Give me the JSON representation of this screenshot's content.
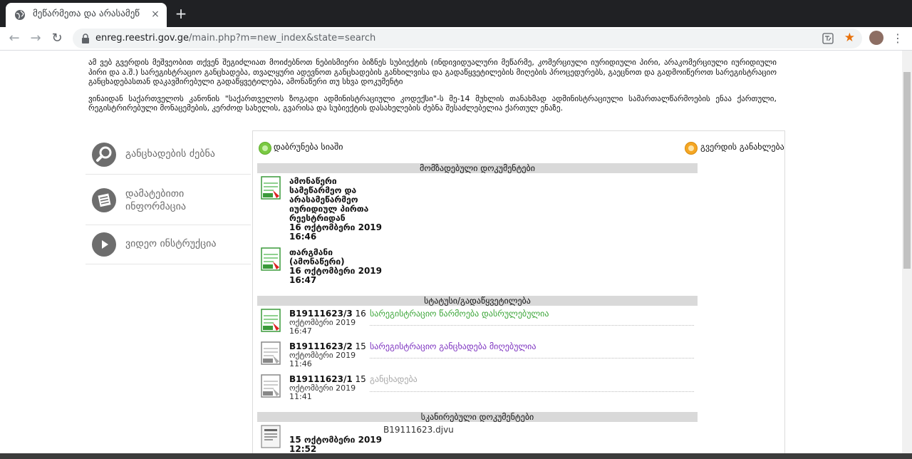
{
  "browser": {
    "tab_title": "მეწარმეთა და არასამეწ",
    "tab_close": "×",
    "new_tab": "+",
    "url_host": "enreg.reestri.gov.ge",
    "url_path": "/main.php?m=new_index&state=search",
    "back": "←",
    "forward": "→",
    "reload": "↻",
    "star": "★",
    "menu": "⋮"
  },
  "intro": {
    "p1": "ამ ვებ გვერდის მეშვეობით თქვენ შეგიძლიათ მოიძებნოთ ნებისმიერი ბიზნეს სუბიექტის (ინდივიდუალური მეწარმე, კომერციული იურიდიული პირი, არაკომერციული იურიდიული პირი და ა.შ.) სარეგისტრაციო განცხადება, თვალყური ადევნოთ განცხადების განხილვისა და გადაწყვეტილების მიღების პროცედურებს, გაეცნოთ და გადმოიწეროთ სარეგისტრაციო განცხადებასთან დაკავშირებული გადაწყვეტილება, ამონაწერი თუ სხვა დოკუმენტი",
    "p2": "ვინაიდან საქართველოს კანონის \"საქართველოს ზოგადი ადმინისტრაციული კოდექსი\"-ს მე-14 მუხლის თანახმად ადმინისტრაციული სამართალწარმოების ენაა ქართული, რეგისტრირებული მონაცემების, კერძოდ სახელის, გვარისა და სუბიექტის დასახელების ძებნა შესაძლებელია ქართულ ენაზე."
  },
  "sidenav": [
    {
      "label_line1": "განცხადების ძებნა",
      "label_line2": ""
    },
    {
      "label_line1": "დამატებითი",
      "label_line2": "ინფორმაცია"
    },
    {
      "label_line1": "ვიდეო ინსტრუქცია",
      "label_line2": ""
    }
  ],
  "panel": {
    "back_label": "დაბრუნება სიაში",
    "refresh_label": "გვერდის განახლება",
    "prepared_header": "მომზადებული დოკუმენტები",
    "prepared": [
      {
        "title": [
          "ამონაწერი",
          "სამეწარმეო და",
          "არასამეწარმეო",
          "იურიდიულ პირთა",
          "რეესტრიდან"
        ],
        "date": "16 ოქტომბერი 2019",
        "time": "16:46"
      },
      {
        "title": [
          "თარგმანი",
          "(ამონაწერი)"
        ],
        "date": "16 ოქტომბერი 2019",
        "time": "16:47"
      }
    ],
    "status_header": "სტატუსი/გადაწყვეტილება",
    "statuses": [
      {
        "code": "B19111623/3",
        "day": "16",
        "month_year": "ოქტომბერი 2019",
        "time": "16:47",
        "status": "სარეგისტრაციო წარმოება დასრულებულია",
        "color": "#3aa537"
      },
      {
        "code": "B19111623/2",
        "day": "15",
        "month_year": "ოქტომბერი 2019",
        "time": "11:46",
        "status": "სარეგისტრაციო განცხადება მიღებულია",
        "color": "#7b2fbf"
      },
      {
        "code": "B19111623/1",
        "day": "15",
        "month_year": "ოქტომბერი 2019",
        "time": "11:41",
        "status": "განცხადება",
        "color": "#a8a8a8"
      }
    ],
    "scanned_header": "სკანირებული დოკუმენტები",
    "scanned": [
      {
        "date": "15 ოქტომბერი 2019",
        "time": "12:52",
        "file": "B19111623.djvu"
      }
    ]
  }
}
